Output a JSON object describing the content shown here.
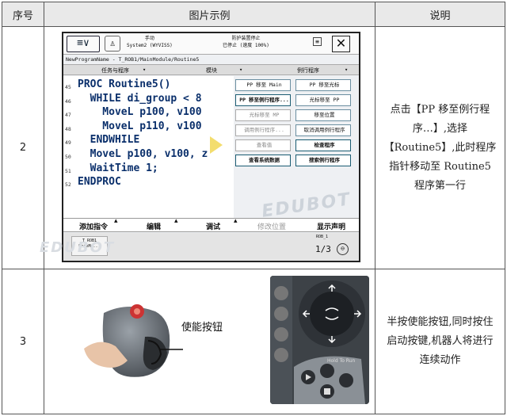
{
  "table": {
    "headers": [
      "序号",
      "图片示例",
      "说明"
    ],
    "rows": [
      {
        "seq": "2",
        "description": "点击【PP 移至例行程序…】,选择【Routine5】,此时程序指针移动至 Routine5 程序第一行"
      },
      {
        "seq": "3",
        "description": "半按使能按钮,同时按住启动按键,机器人将进行连续动作",
        "image_label": "使能按钮"
      }
    ]
  },
  "flexpendant": {
    "status_left": "手动\nSystem2 (WYVISS)",
    "status_right": "防护装置停止\n已停止 (速度 100%)",
    "path": "NewProgramName - T_ROB1/MainModule/Routine5",
    "tabs": [
      "任务与程序",
      "模块",
      "例行程序"
    ],
    "code_lines": [
      {
        "no": "45",
        "text": "PROC Routine5()"
      },
      {
        "no": "46",
        "text": "  WHILE di_group < 8"
      },
      {
        "no": "47",
        "text": "    MoveL p100, v100"
      },
      {
        "no": "48",
        "text": "    MoveL p110, v100"
      },
      {
        "no": "49",
        "text": "  ENDWHILE"
      },
      {
        "no": "50",
        "text": "  MoveL p100, v100, z"
      },
      {
        "no": "51",
        "text": "  WaitTime 1;"
      },
      {
        "no": "52",
        "text": "ENDPROC"
      }
    ],
    "menu_buttons": [
      {
        "label": "PP 移至 Main",
        "state": "normal"
      },
      {
        "label": "PP 移至光标",
        "state": "normal"
      },
      {
        "label": "PP 移至例行程序...",
        "state": "highlight"
      },
      {
        "label": "光标移至 PP",
        "state": "normal"
      },
      {
        "label": "光标移至 MP",
        "state": "gray"
      },
      {
        "label": "移至位置",
        "state": "normal"
      },
      {
        "label": "调用例行程序...",
        "state": "gray"
      },
      {
        "label": "取消调用例行程序",
        "state": "normal"
      },
      {
        "label": "查看值",
        "state": "gray"
      },
      {
        "label": "检查程序",
        "state": "highlight"
      },
      {
        "label": "查看系统数据",
        "state": "highlight"
      },
      {
        "label": "搜索例行程序",
        "state": "highlight"
      }
    ],
    "bottom_bar": [
      "添加指令",
      "编辑",
      "调试",
      "修改位置",
      "显示声明"
    ],
    "task_label": "T_ROB1\nMainMo...",
    "rob_label": "ROB_1",
    "fraction": "1/3",
    "watermark": "EDUBOT"
  },
  "joystick": {
    "text": "Hold To Run"
  }
}
